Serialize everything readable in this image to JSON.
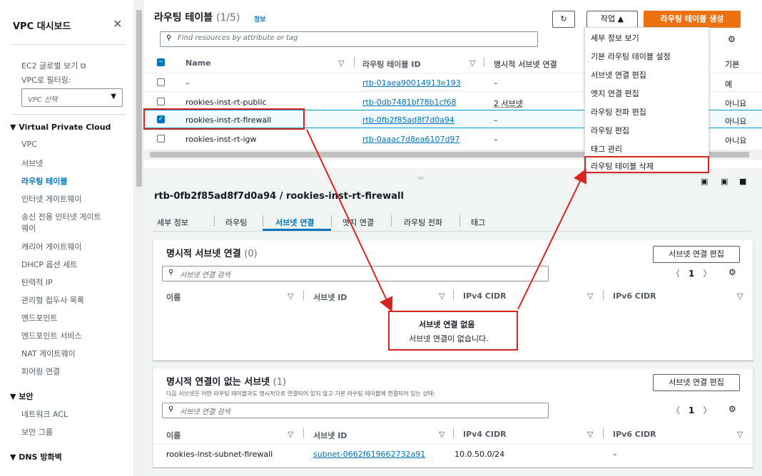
{
  "sidebar": {
    "title": "VPC 대시보드",
    "ec2_link": "EC2 글로벌 보기",
    "filter_label": "VPC로 필터링:",
    "filter_placeholder": "VPC 선택",
    "section_vpc": "Virtual Private Cloud",
    "items": [
      "VPC",
      "서브넷",
      "라우팅 테이블",
      "인터넷 게이트웨이",
      "송신 전용 인터넷 게이트",
      "웨이",
      "캐리어 게이트웨이",
      "DHCP 옵션 세트",
      "탄력적 IP",
      "관리형 접두사 목록",
      "엔드포인트",
      "엔드포인트 서비스",
      "NAT 게이트웨이",
      "피어링 연결"
    ],
    "section_security": "보안",
    "security_items": [
      "네트워크 ACL",
      "보안 그룹"
    ],
    "section_dns": "DNS 방화벽"
  },
  "route_tables": {
    "title": "라우팅 테이블",
    "count": "(1/5)",
    "info": "정보",
    "actions_label": "작업",
    "create_label": "라우팅 테이블 생성",
    "search_placeholder": "Find resources by attribute or tag",
    "columns": [
      "Name",
      "라우팅 테이블 ID",
      "명시적 서브넷 연결",
      "기본"
    ],
    "rows": [
      {
        "name": "–",
        "id": "rtb-01aea90014913e193",
        "subnet": "–",
        "main": "예"
      },
      {
        "name": "rookies-inst-rt-public",
        "id": "rtb-0db7481bf78b1cf68",
        "subnet": "2 서브넷",
        "main": "아니요"
      },
      {
        "name": "rookies-inst-rt-firewall",
        "id": "rtb-0fb2f85ad8f7d0a94",
        "subnet": "–",
        "main": "아니요"
      },
      {
        "name": "rookies-inst-rt-igw",
        "id": "rtb-0aaac7d8ea6107d97",
        "subnet": "–",
        "main": "아니요"
      }
    ]
  },
  "actions_menu": [
    "세부 정보 보기",
    "기본 라우팅 테이블 설정",
    "서브넷 연결 편집",
    "엣지 연결 편집",
    "라우팅 전파 편집",
    "라우팅 편집",
    "태그 관리",
    "라우팅 테이블 삭제"
  ],
  "detail": {
    "title": "rtb-0fb2f85ad8f7d0a94 / rookies-inst-rt-firewall",
    "tabs": [
      "세부 정보",
      "라우팅",
      "서브넷 연결",
      "엣지 연결",
      "라우팅 전파",
      "태그"
    ],
    "explicit": {
      "title": "명시적 서브넷 연결",
      "count": "(0)",
      "edit_label": "서브넷 연결 편집",
      "search_placeholder": "서브넷 연결 검색",
      "page": "1",
      "columns": [
        "이름",
        "서브넷 ID",
        "IPv4 CIDR",
        "IPv6 CIDR"
      ],
      "empty_title": "서브넷 연결 없음",
      "empty_desc": "서브넷 연결이 없습니다."
    },
    "implicit": {
      "title": "명시적 연결이 없는 서브넷",
      "count": "(1)",
      "desc": "다음 서브넷은 어떤 라우팅 테이블과도 명시적으로 연결되어 있지 않고 기본 라우팅 테이블에 연결되어 있는 상태:",
      "edit_label": "서브넷 연결 편집",
      "search_placeholder": "서브넷 연결 검색",
      "page": "1",
      "columns": [
        "이름",
        "서브넷 ID",
        "IPv4 CIDR",
        "IPv6 CIDR"
      ],
      "row": {
        "name": "rookies-inst-subnet-firewall",
        "id": "subnet-0662f619662732a91",
        "ipv4": "10.0.50.0/24",
        "ipv6": "–"
      }
    }
  },
  "colors": {
    "accent": "#0073bb",
    "orange": "#ec7211",
    "annotation": "#d9231f"
  }
}
